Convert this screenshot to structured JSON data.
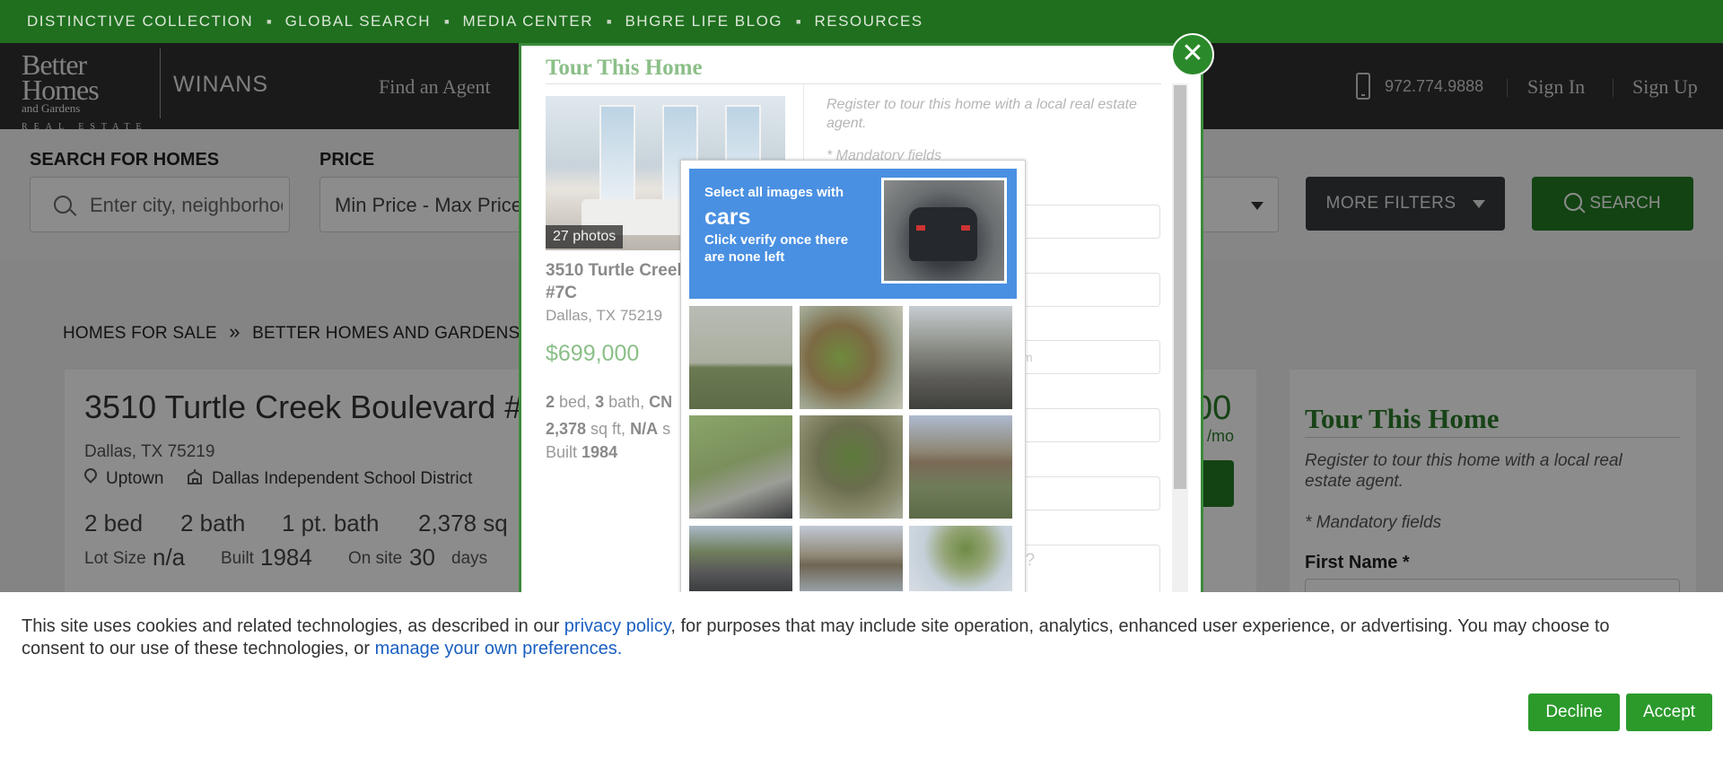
{
  "topbar": {
    "links": [
      "DISTINCTIVE COLLECTION",
      "GLOBAL SEARCH",
      "MEDIA CENTER",
      "BHGRE LIFE BLOG",
      "RESOURCES"
    ]
  },
  "header": {
    "logo_line1": "Better",
    "logo_line2": "Homes",
    "logo_line3": "and Gardens",
    "logo_line4": "REAL ESTATE",
    "brand": "WINANS",
    "nav_find_agent": "Find an Agent",
    "phone": "972.774.9888",
    "sign_in": "Sign In",
    "sign_up": "Sign Up"
  },
  "search": {
    "label_search": "SEARCH FOR HOMES",
    "placeholder": "Enter city, neighborhood",
    "label_price": "PRICE",
    "price_value": "Min Price  -  Max Price",
    "more_filters": "MORE FILTERS",
    "search_button": "SEARCH"
  },
  "breadcrumb": {
    "home": "HOMES FOR SALE",
    "sep": "»",
    "current": "BETTER HOMES AND GARDENS RE"
  },
  "listing": {
    "address": "3510 Turtle Creek Boulevard #",
    "city": "Dallas, TX 75219",
    "neighborhood": "Uptown",
    "school": "Dallas Independent School District",
    "beds": "2 bed",
    "baths": "2 bath",
    "half_bath": "1 pt. bath",
    "sqft": "2,378 sq",
    "lot_label": "Lot Size",
    "lot_value": "n/a",
    "built_label": "Built",
    "built_value": "1984",
    "onsite_label": "On site",
    "onsite_value": "30",
    "onsite_unit": "days",
    "price_partial": "00",
    "per_month_partial": "/mo"
  },
  "right_panel": {
    "title": "Tour This Home",
    "subtitle": "Register to tour this home with a local real estate agent.",
    "mandatory": "* Mandatory fields",
    "first_name_label": "First Name *"
  },
  "modal": {
    "title": "Tour This Home",
    "photos_badge": "27 photos",
    "address": "3510 Turtle Creek Boulevard #7C",
    "city": "Dallas, TX 75219",
    "price": "$699,000",
    "bed_num": "2",
    "bed_txt": " bed, ",
    "bath_num": "3",
    "bath_txt": " bath, ",
    "cn_txt": "CN",
    "sqft_num": "2,378",
    "sqft_txt": " sq ft, ",
    "na_txt": "N/A",
    "s_txt": " s",
    "built_label": "Built ",
    "built_value": "1984",
    "register_text": "Register to tour this home with a local real estate agent.",
    "mandatory": "* Mandatory fields",
    "email_partial": "m",
    "question_partial": "s?",
    "close_icon": "✕"
  },
  "captcha": {
    "line1": "Select all images with",
    "target": "cars",
    "line3": "Click verify once there are none left"
  },
  "cookie": {
    "text_before": "This site uses cookies and related technologies, as described in our ",
    "privacy_link": "privacy policy",
    "text_middle": ", for purposes that may include site operation, analytics, enhanced user experience, or advertising. You may choose to",
    "text_line2": "consent to our use of these technologies, or ",
    "prefs_link": "manage your own preferences.",
    "decline": "Decline",
    "accept": "Accept"
  }
}
